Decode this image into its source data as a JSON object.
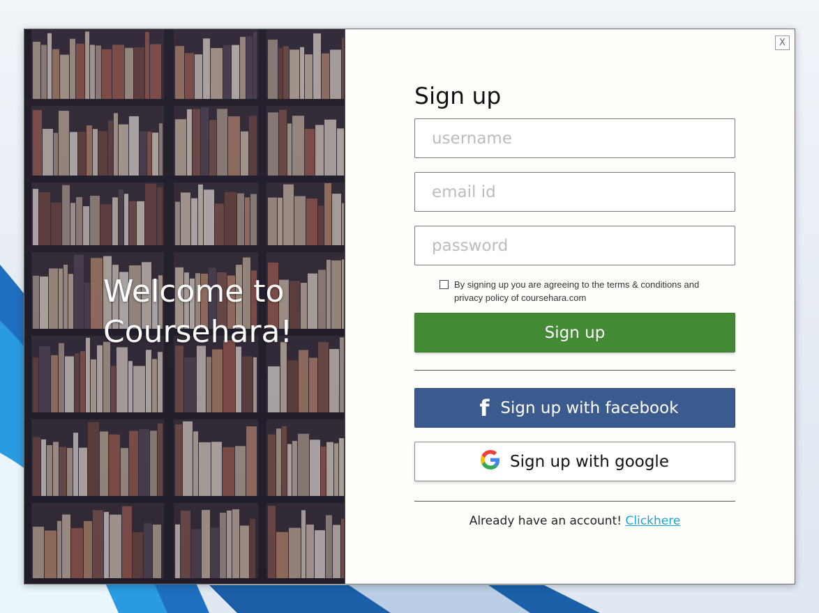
{
  "hero": {
    "welcome_line1": "Welcome to",
    "welcome_line2": "Coursehara!"
  },
  "close_label": "X",
  "form": {
    "title": "Sign up",
    "username_placeholder": "username",
    "email_placeholder": "email id",
    "password_placeholder": "password",
    "terms_text": "By signing up you are agreeing to the terms & conditions and privacy policy of coursehara.com",
    "signup_label": "Sign up",
    "facebook_label": "Sign up with facebook",
    "google_label": "Sign up with google",
    "login_prompt": "Already have an account!",
    "login_link": "Clickhere"
  },
  "colors": {
    "signup_button": "#428a33",
    "facebook_button": "#3b5b8f",
    "link": "#1aa3d6"
  }
}
